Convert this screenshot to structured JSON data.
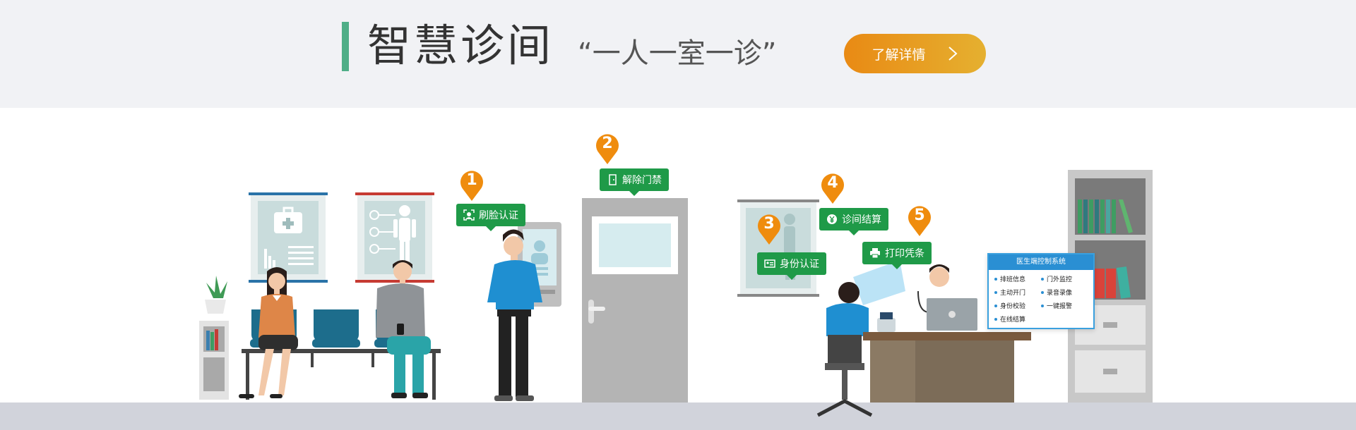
{
  "header": {
    "title": "智慧诊间",
    "slogan": "“一人一室一诊”",
    "cta_label": "了解详情"
  },
  "steps": [
    {
      "number": "1",
      "label": "刷脸认证",
      "icon": "face-scan-icon"
    },
    {
      "number": "2",
      "label": "解除门禁",
      "icon": "door-icon"
    },
    {
      "number": "3",
      "label": "身份认证",
      "icon": "id-card-icon"
    },
    {
      "number": "4",
      "label": "诊间结算",
      "icon": "yuan-coin-icon"
    },
    {
      "number": "5",
      "label": "打印凭条",
      "icon": "printer-icon"
    }
  ],
  "panel": {
    "title": "医生端控制系统",
    "items": [
      "排班信息",
      "门外监控",
      "主动开门",
      "录音录像",
      "身份校验",
      "一键报警",
      "在线结算"
    ]
  },
  "colors": {
    "header_bg": "#f1f2f5",
    "accent_green": "#4fae87",
    "cta_gradient_start": "#e98a14",
    "cta_gradient_end": "#e5b030",
    "bubble_green": "#1f9a48",
    "pin_orange": "#ef8c0e",
    "panel_blue": "#2a8fd3"
  }
}
